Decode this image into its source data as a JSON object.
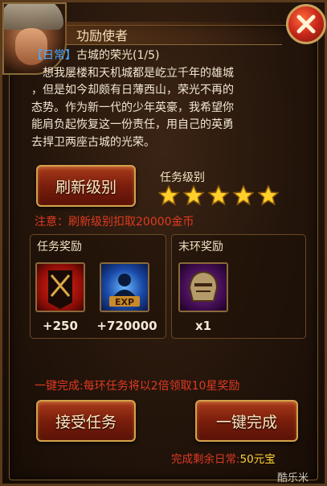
{
  "window": {
    "title": "功励使者"
  },
  "quest": {
    "tag": "【日常】",
    "title": "古城的荣光(1/5)",
    "description_lines": [
      "　想我屡楼和天机城都是屹立千年的雄城",
      "，但是如今却颇有日薄西山，荣光不再的",
      "态势。作为新一代的少年英豪，我希望你",
      "能肩负起恢复这一份责任，用自己的英勇",
      "去捍卫两座古城的光荣。"
    ]
  },
  "refresh": {
    "button_label": "刷新级别",
    "level_label": "任务级别",
    "stars": 5,
    "warning": "注意：刷新级别扣取20000金币"
  },
  "rewards": {
    "task_title": "任务奖励",
    "final_title": "末环奖励",
    "task_items": [
      {
        "icon": "banner-icon",
        "count": "+250"
      },
      {
        "icon": "exp-icon",
        "count": "+720000"
      }
    ],
    "final_items": [
      {
        "icon": "helmet-icon",
        "count": "x1"
      }
    ]
  },
  "footer": {
    "bonus_note": "一键完成:每环任务将以2倍领取10星奖励",
    "accept_label": "接受任务",
    "complete_label": "一键完成",
    "cost_prefix": "完成剩余日常:",
    "cost_value": "50元宝",
    "watermark": "酷乐米"
  },
  "colors": {
    "accent_red": "#e03a22",
    "daily_blue": "#4aa8ff",
    "gold": "#ffd23a"
  }
}
